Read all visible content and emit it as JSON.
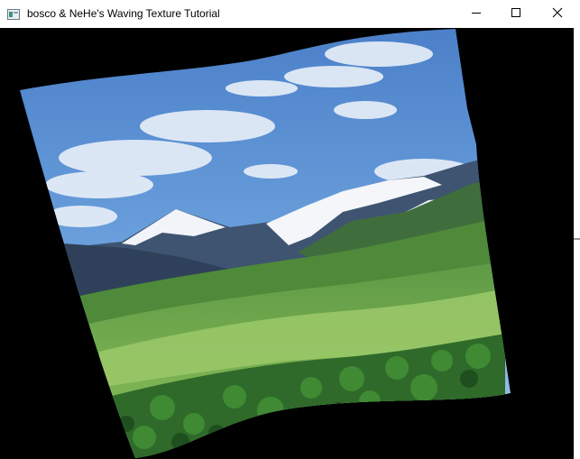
{
  "window": {
    "title": "bosco & NeHe's Waving Texture Tutorial",
    "icon": "opengl-app-icon",
    "controls": {
      "minimize_icon": "minimize-icon",
      "maximize_icon": "maximize-icon",
      "close_icon": "close-icon"
    }
  },
  "viewport": {
    "background": "#000000",
    "scene": "waving-texture-mountain-landscape",
    "colors": {
      "sky": "#5a8fd4",
      "snow": "#f2f4f8",
      "rock": "#3d5068",
      "grass": "#6ea84a",
      "forest": "#2f6a2a"
    }
  }
}
